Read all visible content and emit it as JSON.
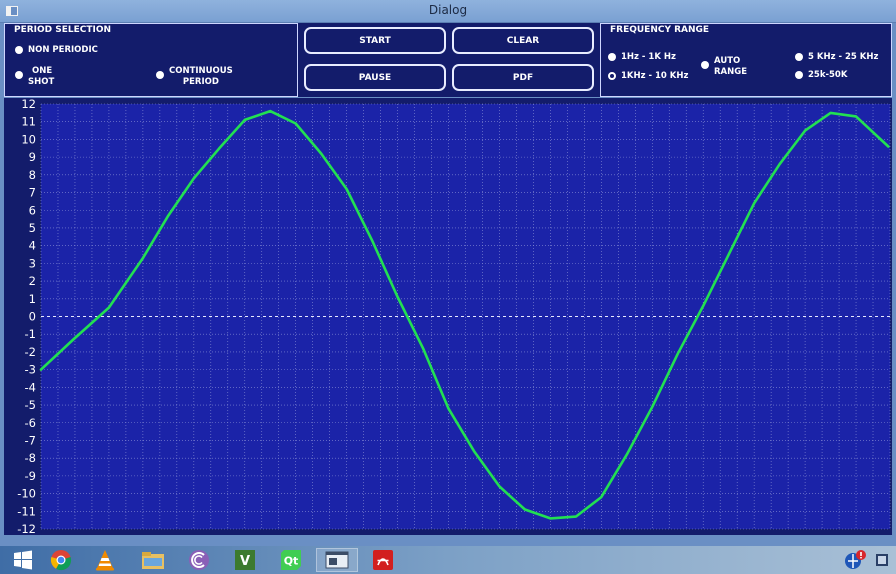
{
  "window": {
    "title": "Dialog"
  },
  "period_selection": {
    "title": "PERIOD SELECTION",
    "options": [
      {
        "label": "NON PERIODIC"
      },
      {
        "line1": "ONE",
        "line2": "SHOT"
      },
      {
        "line1": "CONTINUOUS",
        "line2": "PERIOD"
      }
    ]
  },
  "controls": {
    "start": "START",
    "clear": "CLEAR",
    "pause": "PAUSE",
    "pdf": "PDF"
  },
  "frequency_range": {
    "title": "FREQUENCY RANGE",
    "options": [
      {
        "label": "1Hz - 1K Hz",
        "checked": false
      },
      {
        "label": "1KHz - 10 KHz",
        "checked": true
      },
      {
        "line1": "AUTO",
        "line2": "RANGE",
        "checked": false
      },
      {
        "label": "5 KHz - 25 KHz",
        "checked": false
      },
      {
        "label": "25k-50K",
        "checked": false
      }
    ]
  },
  "colors": {
    "panel_bg": "#131c6b",
    "plot_bg": "#1b23a8",
    "trace": "#22e052",
    "grid": "#8a90d6"
  },
  "chart_data": {
    "type": "line",
    "ylim": [
      -12,
      12
    ],
    "yticks": [
      "12",
      "11",
      "10",
      "9",
      "8",
      "7",
      "6",
      "5",
      "4",
      "3",
      "2",
      "1",
      "0",
      "-1",
      "-2",
      "-3",
      "-4",
      "-5",
      "-6",
      "-7",
      "-8",
      "-9",
      "-10",
      "-11",
      "-12"
    ],
    "xlim": [
      0,
      100
    ],
    "grid": true,
    "series": [
      {
        "x": [
          0,
          3.8,
          8,
          12,
          15,
          18,
          21,
          24,
          27,
          30,
          33,
          36,
          39,
          42,
          45,
          48,
          51,
          54,
          57,
          60,
          63,
          66,
          69,
          72,
          75,
          78,
          81,
          84,
          87,
          90,
          93,
          96,
          99.8
        ],
        "y": [
          -3,
          -1.3,
          0.5,
          3.3,
          5.7,
          7.8,
          9.5,
          11.1,
          11.6,
          10.9,
          9.2,
          7.2,
          4.3,
          1.1,
          -1.8,
          -5.2,
          -7.6,
          -9.6,
          -10.9,
          -11.4,
          -11.3,
          -10.2,
          -7.8,
          -5.1,
          -2.1,
          0.6,
          3.5,
          6.4,
          8.6,
          10.5,
          11.5,
          11.3,
          9.6
        ]
      }
    ]
  },
  "taskbar": {
    "items": [
      {
        "name": "start-menu-icon"
      },
      {
        "name": "chrome-icon"
      },
      {
        "name": "vlc-icon"
      },
      {
        "name": "file-explorer-icon"
      },
      {
        "name": "media-player-icon"
      },
      {
        "name": "visual-studio-icon"
      },
      {
        "name": "qt-creator-icon"
      },
      {
        "name": "dialog-app-icon"
      },
      {
        "name": "pdf-reader-icon"
      }
    ]
  }
}
